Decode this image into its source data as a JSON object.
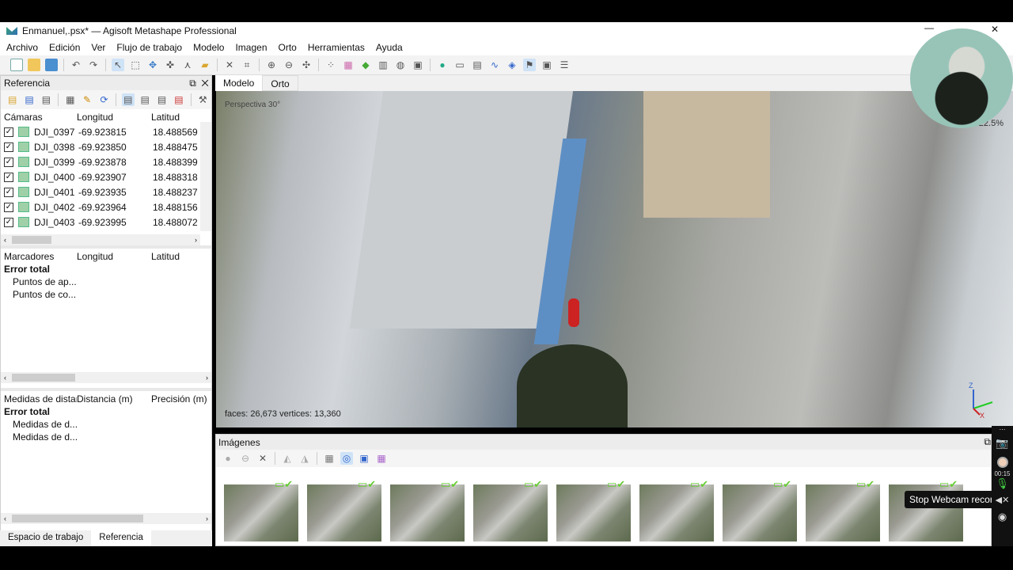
{
  "window": {
    "title": "Enmanuel,.psx* — Agisoft Metashape Professional"
  },
  "menu": [
    "Archivo",
    "Edición",
    "Ver",
    "Flujo de trabajo",
    "Modelo",
    "Imagen",
    "Orto",
    "Herramientas",
    "Ayuda"
  ],
  "reference": {
    "title": "Referencia",
    "cameras": {
      "headers": [
        "Cámaras",
        "Longitud",
        "Latitud"
      ],
      "rows": [
        [
          "DJI_0397",
          "-69.923815",
          "18.488569"
        ],
        [
          "DJI_0398",
          "-69.923850",
          "18.488475"
        ],
        [
          "DJI_0399",
          "-69.923878",
          "18.488399"
        ],
        [
          "DJI_0400",
          "-69.923907",
          "18.488318"
        ],
        [
          "DJI_0401",
          "-69.923935",
          "18.488237"
        ],
        [
          "DJI_0402",
          "-69.923964",
          "18.488156"
        ],
        [
          "DJI_0403",
          "-69.923995",
          "18.488072"
        ]
      ]
    },
    "markers": {
      "headers": [
        "Marcadores",
        "Longitud",
        "Latitud"
      ],
      "total": "Error total",
      "items": [
        "Puntos de ap...",
        "Puntos de co..."
      ]
    },
    "measures": {
      "headers": [
        "Medidas de distar",
        "Distancia (m)",
        "Precisión (m)"
      ],
      "total": "Error total",
      "items": [
        "Medidas de d...",
        "Medidas de d..."
      ]
    }
  },
  "bottom_tabs": [
    "Espacio de trabajo",
    "Referencia"
  ],
  "viewport": {
    "tabs": [
      "Modelo",
      "Orto"
    ],
    "perspective": "Perspectiva 30°",
    "stats": "faces: 26,673 vertices: 13,360",
    "zoom_overlay": "22.5%"
  },
  "images": {
    "title": "Imágenes",
    "count": 9
  },
  "recorder": {
    "time": "00:15",
    "tooltip": "Stop Webcam recording"
  }
}
